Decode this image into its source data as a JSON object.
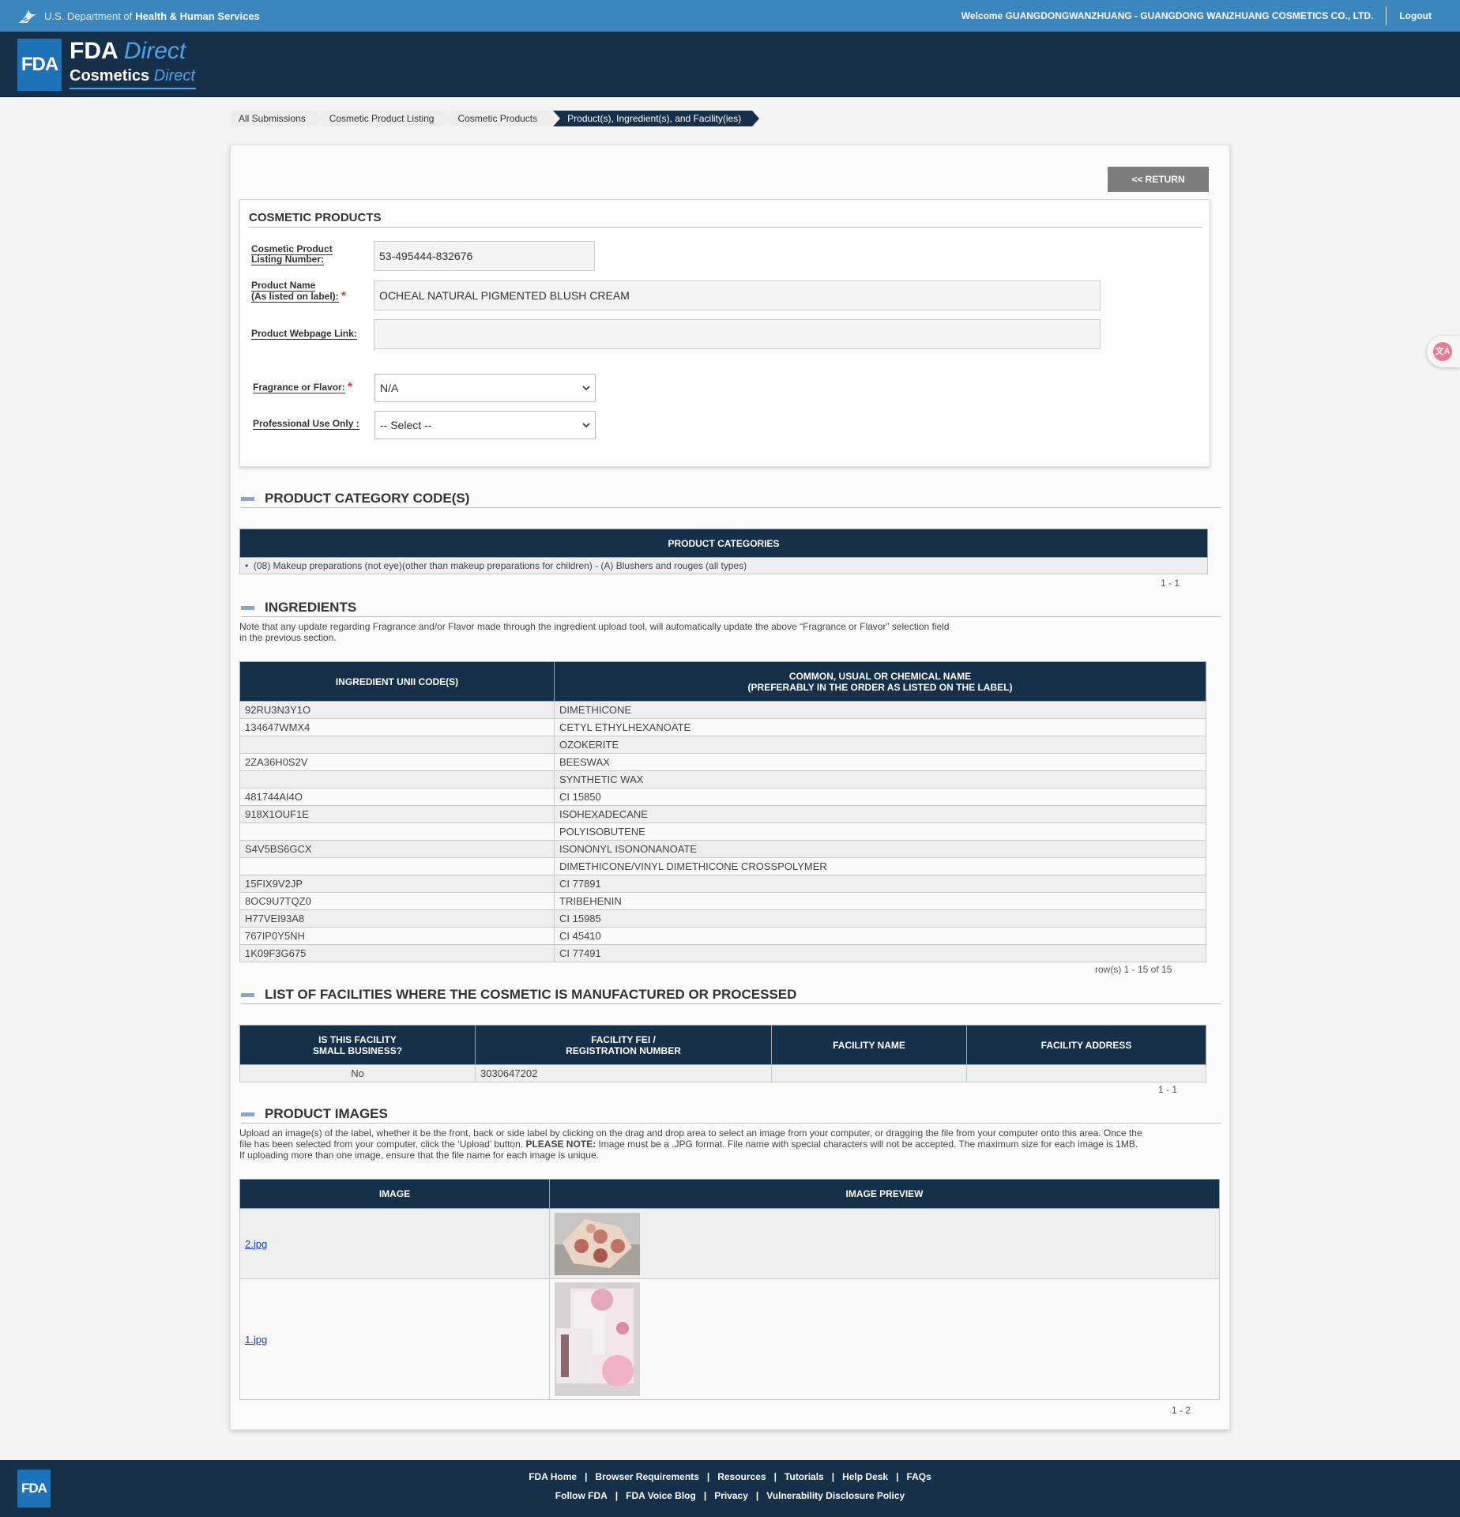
{
  "topbar": {
    "department": "U.S. Department of",
    "department_bold": "Health & Human Services",
    "welcome": "Welcome GUANGDONGWANZHUANG - GUANGDONG WANZHUANG COSMETICS CO., LTD.",
    "logout": "Logout"
  },
  "header": {
    "logo": "FDA",
    "line1_a": "FDA",
    "line1_b": "Direct",
    "line2_a": "Cosmetics",
    "line2_b": "Direct"
  },
  "breadcrumb": [
    "All Submissions",
    "Cosmetic Product Listing",
    "Cosmetic Products",
    "Product(s), Ingredient(s), and Facility(ies)"
  ],
  "return_label": "<< RETURN",
  "cosmetic_products": {
    "title": "COSMETIC PRODUCTS",
    "listing_label_1": "Cosmetic Product",
    "listing_label_2": "Listing Number:",
    "listing_value": "53-495444-832676",
    "name_label_1": "Product Name",
    "name_label_2": "(As listed on label):",
    "name_value": "OCHEAL NATURAL PIGMENTED BLUSH CREAM",
    "webpage_label": "Product Webpage Link:",
    "webpage_value": "",
    "fragrance_label": "Fragrance or Flavor:",
    "fragrance_value": "N/A",
    "professional_label": "Professional Use Only :",
    "professional_value": "-- Select --",
    "required_mark": "*"
  },
  "categories": {
    "title": "PRODUCT CATEGORY CODE(S)",
    "header": "PRODUCT CATEGORIES",
    "items": [
      "(08) Makeup preparations (not eye)(other than makeup preparations for children) - (A) Blushers and rouges (all types)"
    ],
    "pager": "1 - 1"
  },
  "ingredients": {
    "title": "INGREDIENTS",
    "note_1": "Note that any update regarding Fragrance and/or Flavor made through the ingredient upload tool, will automatically update the above “Fragrance or Flavor” selection field",
    "note_2": "in the previous section.",
    "col1": "INGREDIENT UNII CODE(S)",
    "col2_1": "COMMON, USUAL OR CHEMICAL NAME",
    "col2_2": "(PREFERABLY IN THE ORDER AS LISTED ON THE LABEL)",
    "rows": [
      [
        "92RU3N3Y1O",
        "DIMETHICONE"
      ],
      [
        "134647WMX4",
        "CETYL ETHYLHEXANOATE"
      ],
      [
        "",
        "OZOKERITE"
      ],
      [
        "2ZA36H0S2V",
        "BEESWAX"
      ],
      [
        "",
        "SYNTHETIC WAX"
      ],
      [
        "481744AI4O",
        "CI 15850"
      ],
      [
        "918X1OUF1E",
        "ISOHEXADECANE"
      ],
      [
        "",
        "POLYISOBUTENE"
      ],
      [
        "S4V5BS6GCX",
        "ISONONYL ISONONANOATE"
      ],
      [
        "",
        "DIMETHICONE/VINYL DIMETHICONE CROSSPOLYMER"
      ],
      [
        "15FIX9V2JP",
        "CI 77891"
      ],
      [
        "8OC9U7TQZ0",
        "TRIBEHENIN"
      ],
      [
        "H77VEI93A8",
        "CI 15985"
      ],
      [
        "767IP0Y5NH",
        "CI 45410"
      ],
      [
        "1K09F3G675",
        "CI 77491"
      ]
    ],
    "pager": "row(s) 1 - 15 of 15"
  },
  "facilities": {
    "title": "LIST OF FACILITIES WHERE THE COSMETIC IS MANUFACTURED OR PROCESSED",
    "col1_1": "IS THIS FACILITY",
    "col1_2": "SMALL BUSINESS?",
    "col2_1": "FACILITY FEI /",
    "col2_2": "REGISTRATION NUMBER",
    "col3": "FACILITY NAME",
    "col4": "FACILITY ADDRESS",
    "rows": [
      [
        "No",
        "3030647202",
        "",
        ""
      ]
    ],
    "pager": "1 - 1"
  },
  "images": {
    "title": "PRODUCT IMAGES",
    "note_1": "Upload an image(s) of the label, whether it be the front, back or side label by clicking on the drag and drop area to select an image from your computer, or dragging the file from your computer onto this area. Once the",
    "note_2a": "file has been selected from your computer, click the ‘Upload’ button.",
    "note_2b": "PLEASE NOTE:",
    "note_2c": "Image must be a .JPG format. File name with special characters will not be accepted. The maximum size for each image is 1MB.",
    "note_3": "If uploading more than one image, ensure that the file name for each image is unique.",
    "col1": "IMAGE",
    "col2": "IMAGE PREVIEW",
    "rows": [
      {
        "file": "2.jpg"
      },
      {
        "file": "1.jpg"
      }
    ],
    "pager": "1 - 2"
  },
  "footer": {
    "logo": "FDA",
    "row1": [
      "FDA Home",
      "Browser Requirements",
      "Resources",
      "Tutorials",
      "Help Desk",
      "FAQs"
    ],
    "row2": [
      "Follow FDA",
      "FDA Voice Blog",
      "Privacy",
      "Vulnerability Disclosure Policy"
    ]
  },
  "colors": {
    "navy": "#16304a",
    "hhs_blue": "#3a86bd",
    "fda_blue": "#1d72b8",
    "required": "#dd3333"
  }
}
